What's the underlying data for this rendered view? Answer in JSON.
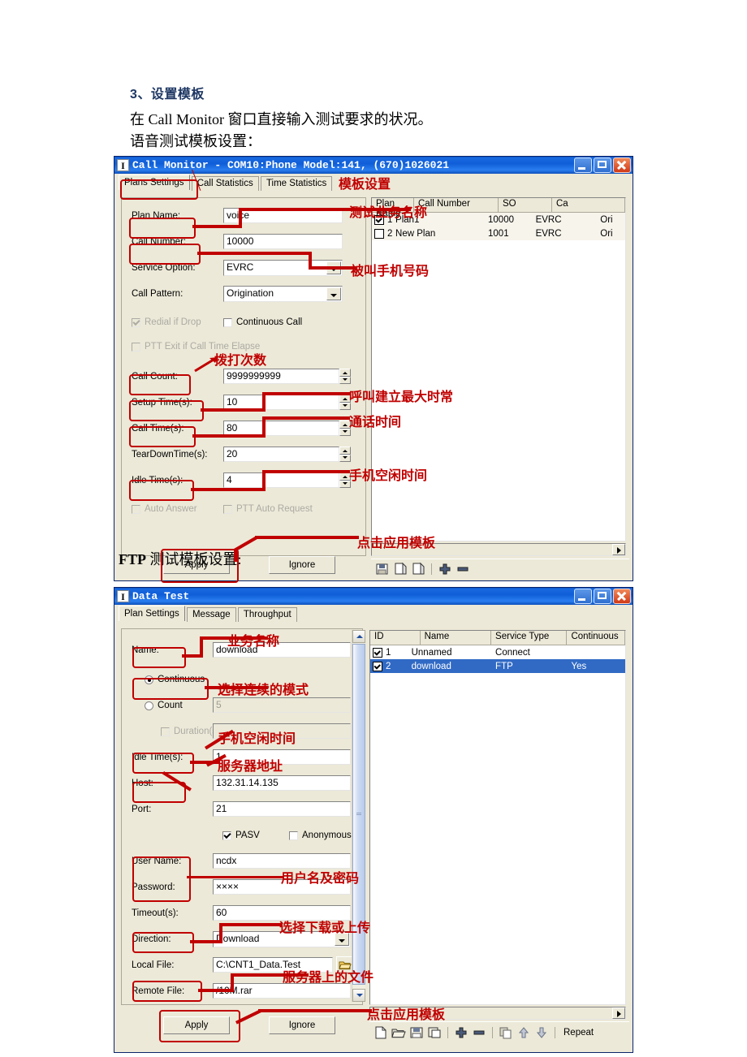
{
  "document": {
    "heading": "3、设置模板",
    "line1": "在 Call Monitor 窗口直接输入测试要求的状况。",
    "line2": "语音测试模板设置：",
    "ftp_heading_en": "FTP",
    "ftp_heading_cn": " 测试模板设置:"
  },
  "call_monitor": {
    "title": "Call Monitor - COM10:Phone Model:141, (670)1026021",
    "icon": "app-icon",
    "window_buttons": {
      "minimize": "minimize-icon",
      "maximize": "maximize-icon",
      "close": "close-icon"
    },
    "tabs": [
      {
        "label": "Plans Settings",
        "selected": true
      },
      {
        "label": "Call Statistics",
        "selected": false
      },
      {
        "label": "Time Statistics",
        "selected": false
      }
    ],
    "fields": {
      "plan_name_label": "Plan Name:",
      "plan_name_value": "voice",
      "call_number_label": "Call Number:",
      "call_number_value": "10000",
      "service_option_label": "Service Option:",
      "service_option_value": "EVRC",
      "call_pattern_label": "Call Pattern:",
      "call_pattern_value": "Origination",
      "redial_if_drop": "Redial if Drop",
      "continuous_call": "Continuous Call",
      "ptt_exit": "PTT Exit if Call Time Elapse",
      "call_count_label": "Call Count:",
      "call_count_value": "9999999999",
      "setup_time_label": "Setup Time(s):",
      "setup_time_value": "10",
      "call_time_label": "Call Time(s):",
      "call_time_value": "80",
      "teardown_time_label": "TearDownTime(s):",
      "teardown_time_value": "20",
      "idle_time_label": "Idle Time(s):",
      "idle_time_value": "4",
      "auto_answer": "Auto Answer",
      "ptt_auto_request": "PTT Auto Request"
    },
    "buttons": {
      "apply": "Apply",
      "ignore": "Ignore"
    },
    "plan_list": {
      "columns": [
        "Plan Name",
        "Call Number",
        "SO",
        "Ca"
      ],
      "rows": [
        {
          "id": "1",
          "checked": true,
          "name": "Plan1",
          "call_number": "10000",
          "so": "EVRC",
          "ca": "Ori"
        },
        {
          "id": "2",
          "checked": false,
          "name": "New Plan",
          "call_number": "1001",
          "so": "EVRC",
          "ca": "Ori"
        }
      ]
    }
  },
  "data_test": {
    "title": "Data Test",
    "icon": "app-icon",
    "window_buttons": {
      "minimize": "minimize-icon",
      "maximize": "maximize-icon",
      "close": "close-icon"
    },
    "tabs": [
      {
        "label": "Plan Settings",
        "selected": true
      },
      {
        "label": "Message",
        "selected": false
      },
      {
        "label": "Throughput",
        "selected": false
      }
    ],
    "fields": {
      "name_label": "Name:",
      "name_value": "download",
      "continuous_radio": "Continuous",
      "count_radio": "Count",
      "count_value": "5",
      "duration_check": "Duration(s)",
      "idle_time_label": "Idle Time(s):",
      "idle_time_value": "1",
      "host_label": "Host:",
      "host_value": "132.31.14.135",
      "port_label": "Port:",
      "port_value": "21",
      "pasv_check": "PASV",
      "anonymous_check": "Anonymous",
      "user_name_label": "User Name:",
      "user_name_value": "ncdx",
      "password_label": "Password:",
      "password_value": "××××",
      "timeout_label": "Timeout(s):",
      "timeout_value": "60",
      "direction_label": "Direction:",
      "direction_value": "Download",
      "local_file_label": "Local File:",
      "local_file_value": "C:\\CNT1_Data.Test",
      "remote_file_label": "Remote File:",
      "remote_file_value": "/10M.rar"
    },
    "buttons": {
      "apply": "Apply",
      "ignore": "Ignore",
      "browse": "folder-open-icon"
    },
    "plan_list": {
      "columns": [
        "ID",
        "Name",
        "Service Type",
        "Continuous"
      ],
      "rows": [
        {
          "id": "1",
          "checked": true,
          "name": "Unnamed",
          "service_type": "Connect",
          "continuous": "",
          "selected": false
        },
        {
          "id": "2",
          "checked": true,
          "name": "download",
          "service_type": "FTP",
          "continuous": "Yes",
          "selected": true
        }
      ]
    },
    "toolbar": {
      "icons": [
        "new-icon",
        "open-icon",
        "save-icon",
        "save-as-icon",
        "add-icon",
        "remove-icon",
        "copy-icon",
        "move-up-icon",
        "move-down-icon"
      ],
      "repeat_label": "Repeat"
    }
  },
  "annotations": [
    {
      "id": "a1",
      "text": "模板设置"
    },
    {
      "id": "a2",
      "text": "测试业务名称"
    },
    {
      "id": "a3",
      "text": "被叫手机号码"
    },
    {
      "id": "a4",
      "text": "拨打次数"
    },
    {
      "id": "a5",
      "text": "呼叫建立最大时常"
    },
    {
      "id": "a6",
      "text": "通话时间"
    },
    {
      "id": "a7",
      "text": "手机空闲时间"
    },
    {
      "id": "a8",
      "text": "点击应用模板"
    },
    {
      "id": "a9",
      "text": "业务名称"
    },
    {
      "id": "a10",
      "text": "选择连续的模式"
    },
    {
      "id": "a11",
      "text": "手机空闲时间"
    },
    {
      "id": "a12",
      "text": "服务器地址"
    },
    {
      "id": "a13",
      "text": "用户名及密码"
    },
    {
      "id": "a14",
      "text": "选择下载或上传"
    },
    {
      "id": "a15",
      "text": "服务器上的文件"
    },
    {
      "id": "a16",
      "text": "点击应用模板"
    }
  ],
  "colors": {
    "annotation": "#c00000",
    "title_bar": "#0a54c8",
    "face": "#ece9d8",
    "selection": "#316ac5"
  }
}
